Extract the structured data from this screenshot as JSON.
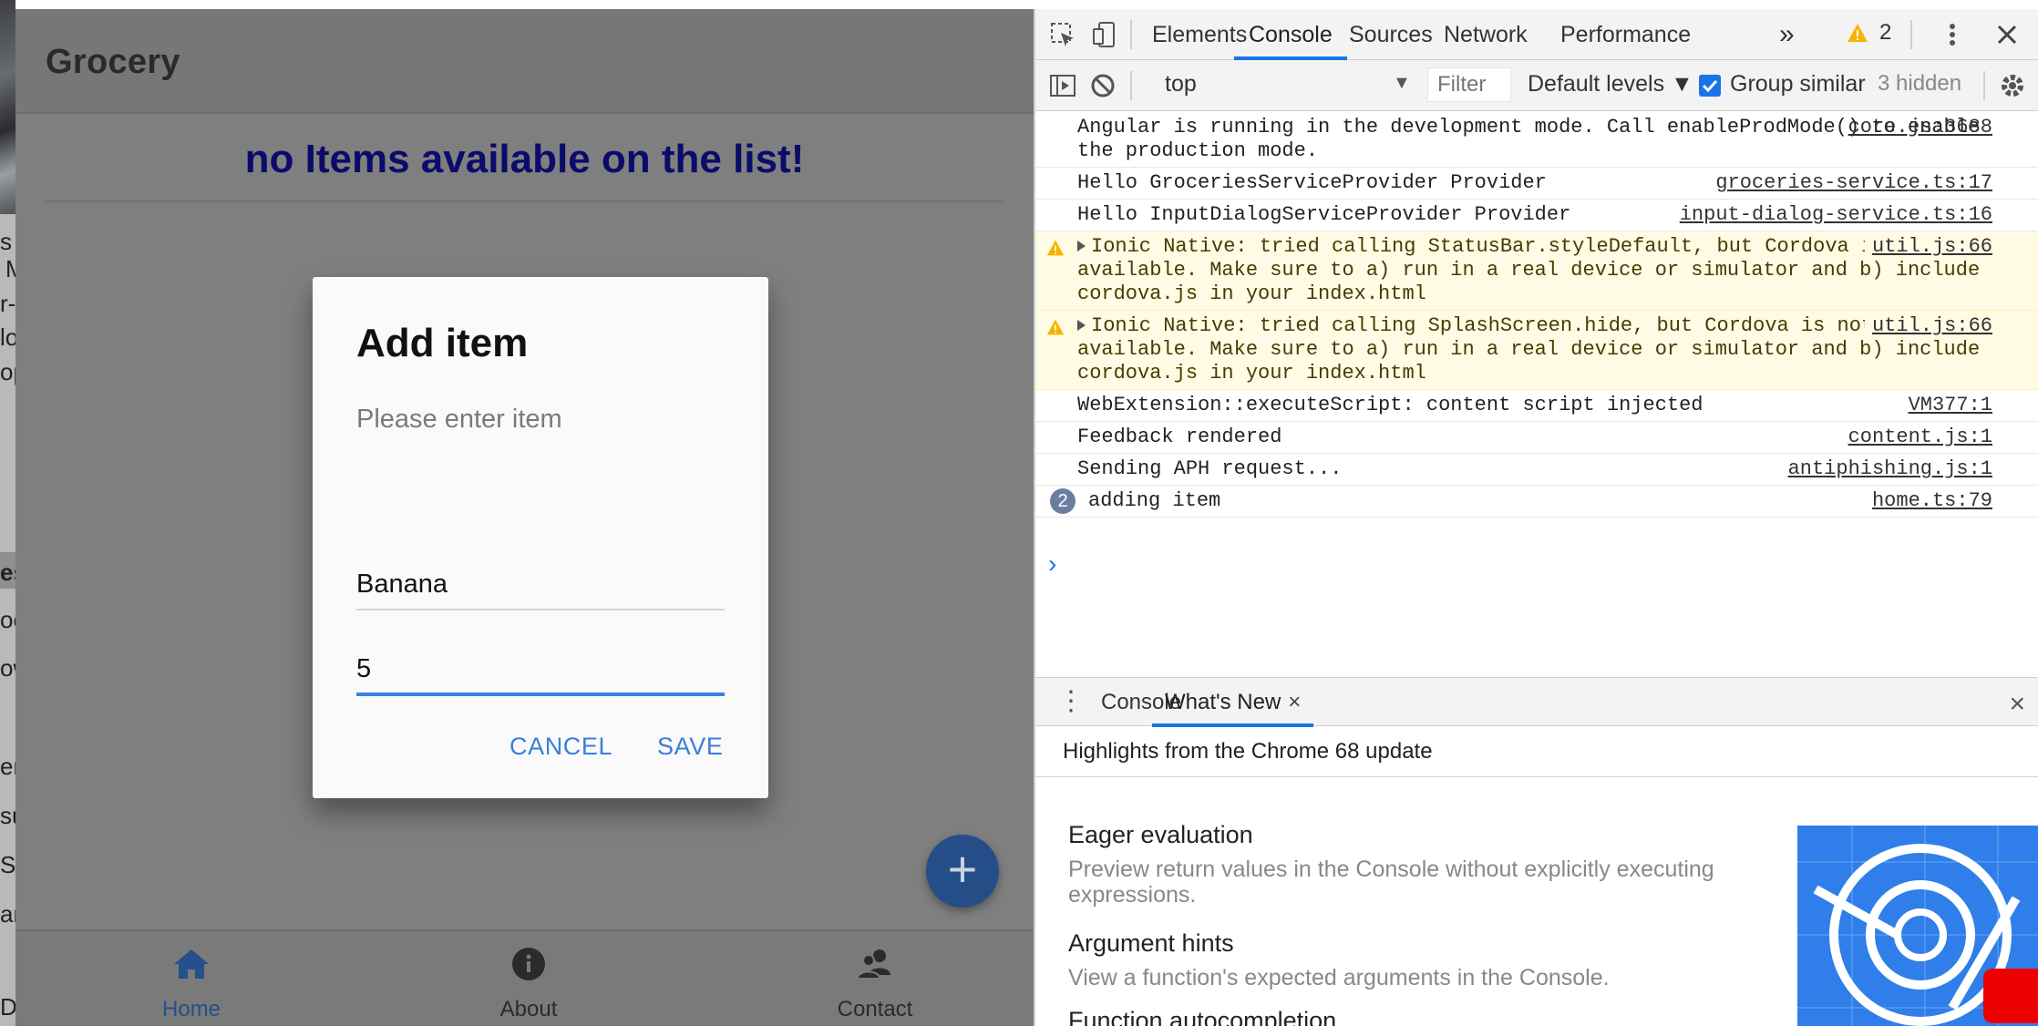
{
  "left_strip": {
    "fragments": [
      "s",
      "M",
      "r-D",
      "lo",
      "op",
      "es",
      "oc",
      "ow",
      "em",
      "su",
      "S-",
      "am",
      "D"
    ]
  },
  "app": {
    "title": "Grocery",
    "empty_message": "no Items available on the list!",
    "fab_label": "+",
    "tabs": [
      {
        "label": "Home",
        "icon": "home-icon",
        "active": true
      },
      {
        "label": "About",
        "icon": "info-icon",
        "active": false
      },
      {
        "label": "Contact",
        "icon": "contacts-icon",
        "active": false
      }
    ]
  },
  "dialog": {
    "title": "Add item",
    "message": "Please enter item",
    "name_value": "Banana",
    "quantity_value": "5",
    "cancel_label": "CANCEL",
    "save_label": "SAVE"
  },
  "devtools": {
    "tabs": [
      "Elements",
      "Console",
      "Sources",
      "Network",
      "Performance"
    ],
    "active_tab": "Console",
    "more_tabs": "»",
    "warning_count": "2",
    "context": "top",
    "filter_placeholder": "Filter",
    "levels": "Default levels ▼",
    "group_similar": "Group similar",
    "hidden": "3 hidden",
    "console_rows": [
      {
        "type": "log",
        "text": "Angular is running in the development mode. Call enableProdMode() to enable the production mode.",
        "source": "core.js:3688"
      },
      {
        "type": "log",
        "text": "Hello GroceriesServiceProvider Provider",
        "source": "groceries-service.ts:17"
      },
      {
        "type": "log",
        "text": "Hello InputDialogServiceProvider Provider",
        "source": "input-dialog-service.ts:16"
      },
      {
        "type": "warn",
        "text": "Ionic Native: tried calling StatusBar.styleDefault, but Cordova is not available. Make sure to a) run in a real device or simulator and b) include cordova.js in your index.html",
        "source": "util.js:66"
      },
      {
        "type": "warn",
        "text": "Ionic Native: tried calling SplashScreen.hide, but Cordova is not available. Make sure to a) run in a real device or simulator and b) include cordova.js in your index.html",
        "source": "util.js:66"
      },
      {
        "type": "log",
        "text": "WebExtension::executeScript: content script injected",
        "source": "VM377:1"
      },
      {
        "type": "log",
        "text": "Feedback rendered",
        "source": "content.js:1"
      },
      {
        "type": "log",
        "text": "Sending APH request...",
        "source": "antiphishing.js:1"
      },
      {
        "type": "grouped",
        "count": "2",
        "text": "adding item",
        "source": "home.ts:79"
      }
    ],
    "prompt": "›",
    "drawer": {
      "tabs": [
        "Console",
        "What's New"
      ],
      "active_tab": "What's New",
      "close_label": "×"
    },
    "highlights": "Highlights from the Chrome 68 update",
    "whats_new": [
      {
        "title": "Eager evaluation",
        "desc": "Preview return values in the Console without explicitly executing expressions."
      },
      {
        "title": "Argument hints",
        "desc": "View a function's expected arguments in the Console."
      },
      {
        "title": "Function autocompletion",
        "desc": ""
      }
    ],
    "colors": {
      "accent": "#1a73e8",
      "warn_bg": "#fffbe5"
    }
  }
}
